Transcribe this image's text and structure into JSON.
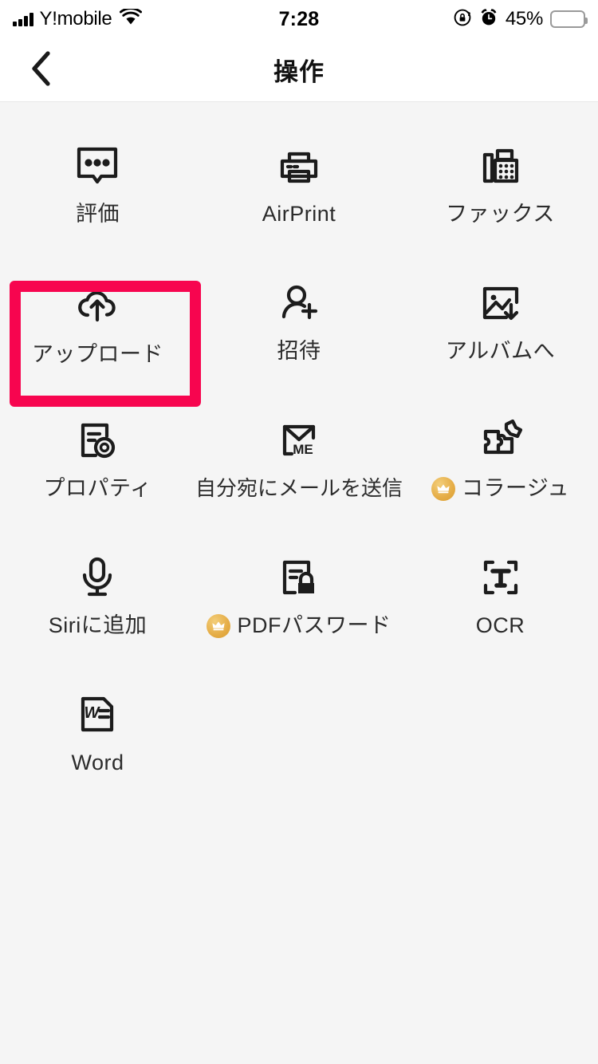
{
  "status_bar": {
    "carrier": "Y!mobile",
    "time": "7:28",
    "battery_percent": "45%",
    "battery_level": 45,
    "battery_color": "#FDCB1B",
    "icons": [
      "signal-bars-icon",
      "wifi-icon",
      "rotation-lock-icon",
      "alarm-clock-icon",
      "battery-icon"
    ]
  },
  "nav_bar": {
    "back_label": "<",
    "title": "操作"
  },
  "highlight": {
    "color": "#F7054F",
    "target": "アップロード"
  },
  "grid": {
    "items": [
      {
        "label": "評価",
        "icon": "comment-dots-icon",
        "premium": false,
        "highlighted": false
      },
      {
        "label": "AirPrint",
        "icon": "printer-icon",
        "premium": false,
        "highlighted": false
      },
      {
        "label": "ファックス",
        "icon": "fax-machine-icon",
        "premium": false,
        "highlighted": false
      },
      {
        "label": "アップロード",
        "icon": "cloud-upload-icon",
        "premium": false,
        "highlighted": true
      },
      {
        "label": "招待",
        "icon": "person-add-icon",
        "premium": false,
        "highlighted": false
      },
      {
        "label": "アルバムへ",
        "icon": "image-download-icon",
        "premium": false,
        "highlighted": false
      },
      {
        "label": "プロパティ",
        "icon": "document-gear-icon",
        "premium": false,
        "highlighted": false
      },
      {
        "label": "自分宛にメールを送信",
        "icon": "envelope-me-icon",
        "premium": false,
        "highlighted": false
      },
      {
        "label": "コラージュ",
        "icon": "puzzle-collage-icon",
        "premium": true,
        "highlighted": false
      },
      {
        "label": "Siriに追加",
        "icon": "microphone-icon",
        "premium": false,
        "highlighted": false
      },
      {
        "label": "PDFパスワード",
        "icon": "document-lock-icon",
        "premium": true,
        "highlighted": false
      },
      {
        "label": "OCR",
        "icon": "text-scan-icon",
        "premium": false,
        "highlighted": false
      },
      {
        "label": "Word",
        "icon": "word-document-icon",
        "premium": false,
        "highlighted": false
      }
    ]
  }
}
